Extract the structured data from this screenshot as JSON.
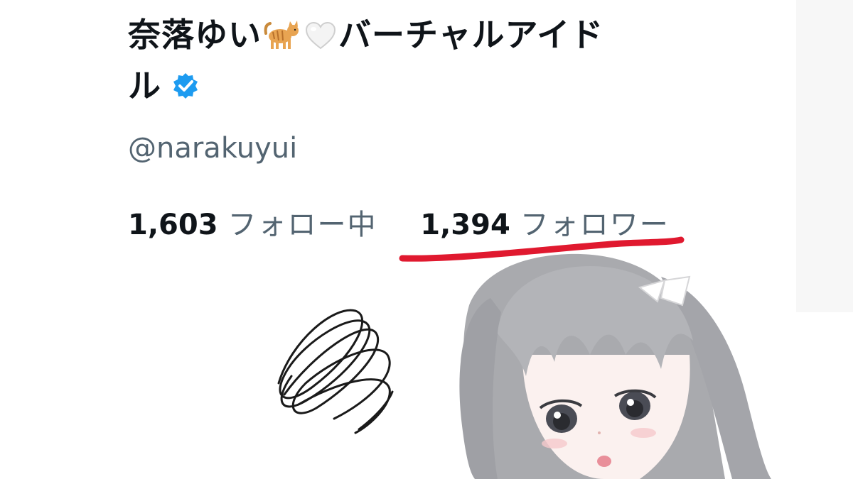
{
  "profile": {
    "display_name_part1": "奈落ゆい",
    "cat_emoji": "🐈",
    "heart_emoji": "🤍",
    "display_name_part2": "バーチャルアイド",
    "display_name_part3": "ル",
    "verified_icon": "verified-badge-icon",
    "handle": "@narakuyui"
  },
  "stats": {
    "following_count": "1,603",
    "following_label": "フォロー中",
    "followers_count": "1,394",
    "followers_label": "フォロワー"
  },
  "colors": {
    "text": "#0f1419",
    "secondary": "#536471",
    "verified": "#1d9bf0",
    "underline_marker": "#e0192f"
  }
}
